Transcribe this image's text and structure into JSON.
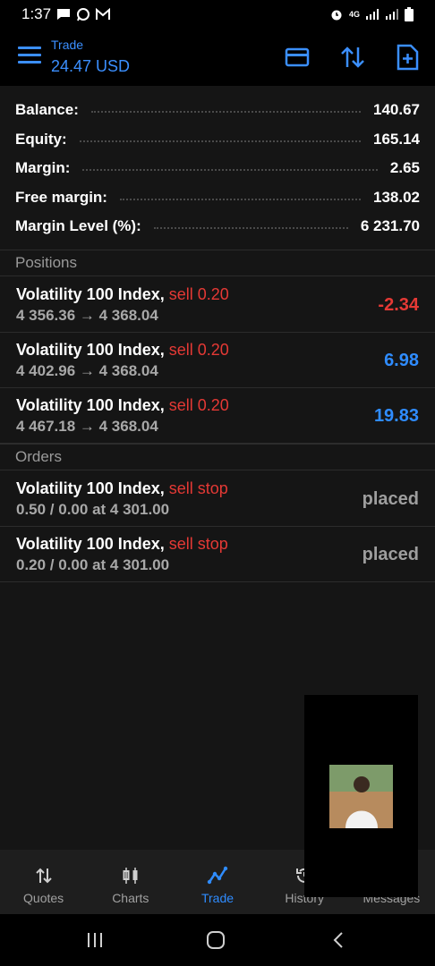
{
  "status_bar": {
    "time": "1:37",
    "icons": [
      "chat-icon",
      "whatsapp-icon",
      "gmail-icon"
    ],
    "right_icons": [
      "alarm-icon",
      "4g-icon",
      "signal-icon",
      "signal-icon",
      "battery-icon"
    ],
    "network": "4G"
  },
  "header": {
    "title": "Trade",
    "subtitle": "24.47 USD",
    "actions": [
      "card-icon",
      "sort-arrows-icon",
      "new-order-icon"
    ]
  },
  "summary": [
    {
      "label": "Balance:",
      "value": "140.67"
    },
    {
      "label": "Equity:",
      "value": "165.14"
    },
    {
      "label": "Margin:",
      "value": "2.65"
    },
    {
      "label": "Free margin:",
      "value": "138.02"
    },
    {
      "label": "Margin Level (%):",
      "value": "6 231.70"
    }
  ],
  "positions": {
    "header": "Positions",
    "items": [
      {
        "symbol": "Volatility 100 Index,",
        "side": "sell 0.20",
        "prices": "4 356.36 → 4 368.04",
        "profit": "-2.34",
        "sign": "neg"
      },
      {
        "symbol": "Volatility 100 Index,",
        "side": "sell 0.20",
        "prices": "4 402.96 → 4 368.04",
        "profit": "6.98",
        "sign": "pos"
      },
      {
        "symbol": "Volatility 100 Index,",
        "side": "sell 0.20",
        "prices": "4 467.18 → 4 368.04",
        "profit": "19.83",
        "sign": "pos"
      }
    ]
  },
  "orders": {
    "header": "Orders",
    "items": [
      {
        "symbol": "Volatility 100 Index,",
        "side": "sell stop",
        "detail": "0.50 / 0.00 at 4 301.00",
        "status": "placed"
      },
      {
        "symbol": "Volatility 100 Index,",
        "side": "sell stop",
        "detail": "0.20 / 0.00 at 4 301.00",
        "status": "placed"
      }
    ]
  },
  "bottom_nav": {
    "items": [
      {
        "label": "Quotes",
        "icon": "quotes-arrows-icon"
      },
      {
        "label": "Charts",
        "icon": "candlestick-icon"
      },
      {
        "label": "Trade",
        "icon": "trade-line-icon",
        "active": true
      },
      {
        "label": "History",
        "icon": "history-icon"
      },
      {
        "label": "Messages",
        "icon": "messages-icon"
      }
    ]
  },
  "colors": {
    "accent": "#2f8cff",
    "negative": "#e53935",
    "background": "#151515"
  }
}
